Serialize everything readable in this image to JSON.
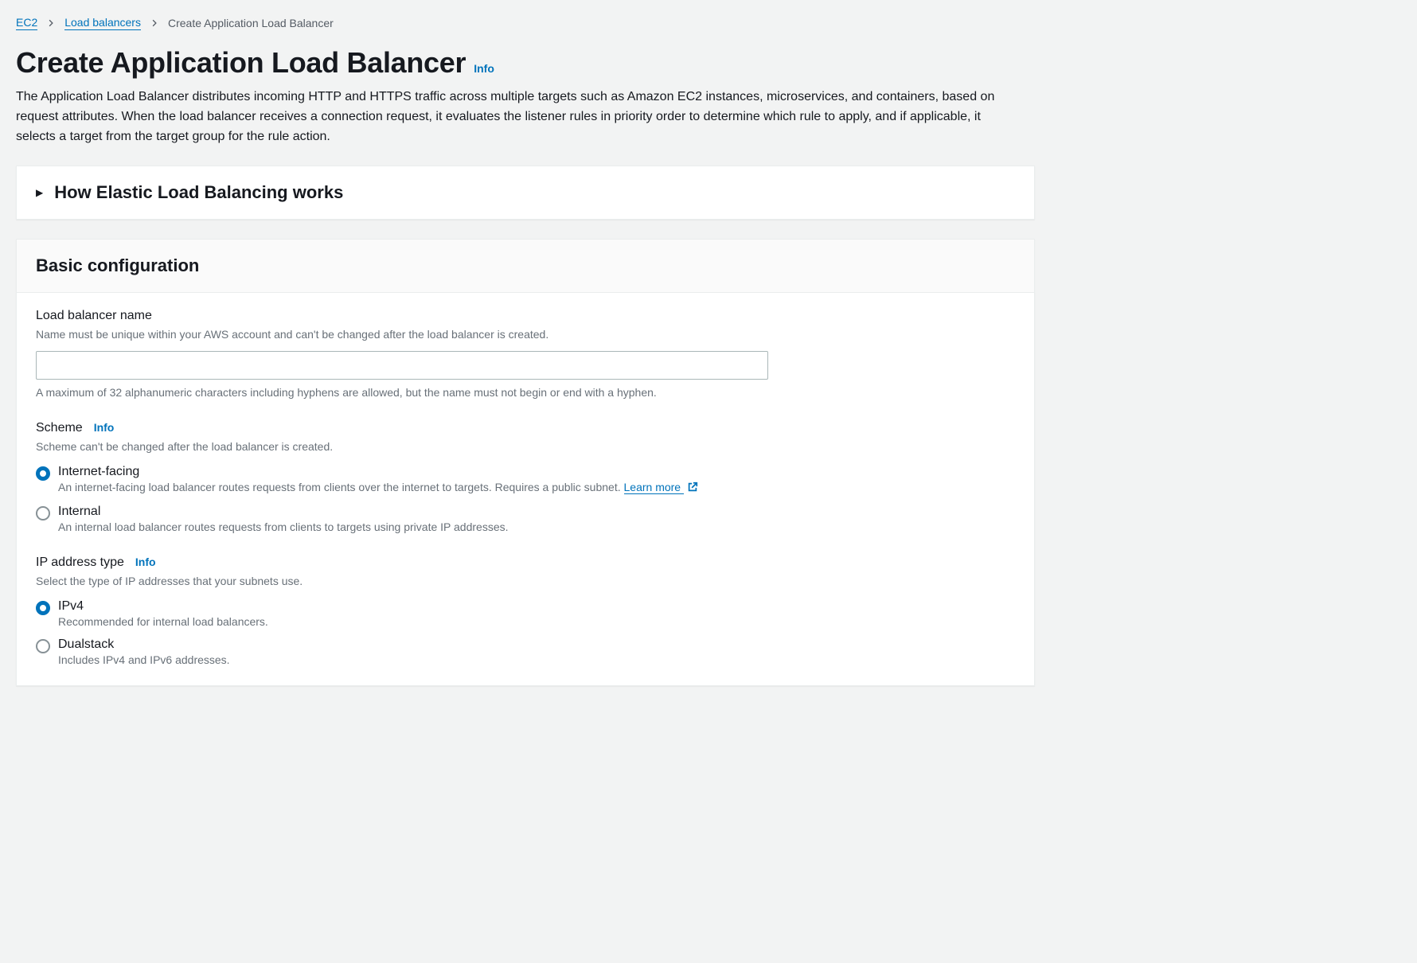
{
  "breadcrumb": {
    "items": [
      {
        "label": "EC2",
        "link": true
      },
      {
        "label": "Load balancers",
        "link": true
      },
      {
        "label": "Create Application Load Balancer",
        "link": false
      }
    ]
  },
  "header": {
    "title": "Create Application Load Balancer",
    "info": "Info",
    "description": "The Application Load Balancer distributes incoming HTTP and HTTPS traffic across multiple targets such as Amazon EC2 instances, microservices, and containers, based on request attributes. When the load balancer receives a connection request, it evaluates the listener rules in priority order to determine which rule to apply, and if applicable, it selects a target from the target group for the rule action."
  },
  "expandable": {
    "title": "How Elastic Load Balancing works"
  },
  "basic": {
    "title": "Basic configuration",
    "name": {
      "label": "Load balancer name",
      "hint": "Name must be unique within your AWS account and can't be changed after the load balancer is created.",
      "value": "",
      "constraint": "A maximum of 32 alphanumeric characters including hyphens are allowed, but the name must not begin or end with a hyphen."
    },
    "scheme": {
      "label": "Scheme",
      "info": "Info",
      "hint": "Scheme can't be changed after the load balancer is created.",
      "options": [
        {
          "label": "Internet-facing",
          "desc_prefix": "An internet-facing load balancer routes requests from clients over the internet to targets. Requires a public subnet. ",
          "learn_more": "Learn more ",
          "checked": true
        },
        {
          "label": "Internal",
          "desc": "An internal load balancer routes requests from clients to targets using private IP addresses.",
          "checked": false
        }
      ]
    },
    "ip_type": {
      "label": "IP address type",
      "info": "Info",
      "hint": "Select the type of IP addresses that your subnets use.",
      "options": [
        {
          "label": "IPv4",
          "desc": "Recommended for internal load balancers.",
          "checked": true
        },
        {
          "label": "Dualstack",
          "desc": "Includes IPv4 and IPv6 addresses.",
          "checked": false
        }
      ]
    }
  }
}
